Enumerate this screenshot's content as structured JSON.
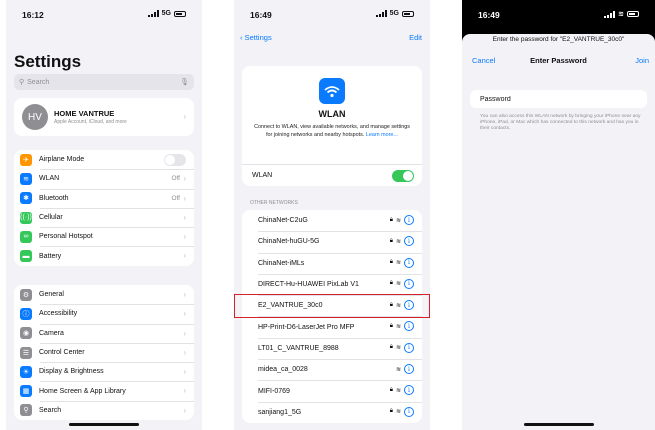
{
  "panel1": {
    "time": "16:12",
    "network": "5G",
    "title": "Settings",
    "search_placeholder": "Search",
    "account": {
      "initials": "HV",
      "name": "HOME VANTRUE",
      "subtitle": "Apple Account, iCloud, and more"
    },
    "network_group": [
      {
        "label": "Airplane Mode",
        "value": "",
        "icon": "airplane-icon",
        "color": "#ff9500",
        "glyph": "✈",
        "toggle": true
      },
      {
        "label": "WLAN",
        "value": "Off",
        "icon": "wifi-icon",
        "color": "#0a7aff",
        "glyph": "≋",
        "toggle": false
      },
      {
        "label": "Bluetooth",
        "value": "Off",
        "icon": "bluetooth-icon",
        "color": "#0a7aff",
        "glyph": "✱",
        "toggle": false
      },
      {
        "label": "Cellular",
        "value": "",
        "icon": "cellular-icon",
        "color": "#34c759",
        "glyph": "((·))",
        "toggle": false
      },
      {
        "label": "Personal Hotspot",
        "value": "",
        "icon": "hotspot-icon",
        "color": "#34c759",
        "glyph": "∞",
        "toggle": false
      },
      {
        "label": "Battery",
        "value": "",
        "icon": "battery-icon",
        "color": "#34c759",
        "glyph": "▬",
        "toggle": false
      }
    ],
    "general_group": [
      {
        "label": "General",
        "icon": "gear-icon",
        "color": "#8e8e93",
        "glyph": "⚙"
      },
      {
        "label": "Accessibility",
        "icon": "accessibility-icon",
        "color": "#0a7aff",
        "glyph": "ⓘ"
      },
      {
        "label": "Camera",
        "icon": "camera-icon",
        "color": "#8e8e93",
        "glyph": "◉"
      },
      {
        "label": "Control Center",
        "icon": "control-center-icon",
        "color": "#8e8e93",
        "glyph": "☰"
      },
      {
        "label": "Display & Brightness",
        "icon": "brightness-icon",
        "color": "#0a7aff",
        "glyph": "☀"
      },
      {
        "label": "Home Screen & App Library",
        "icon": "home-screen-icon",
        "color": "#0a7aff",
        "glyph": "▦"
      },
      {
        "label": "Search",
        "icon": "search-icon",
        "color": "#8e8e93",
        "glyph": "⚲"
      }
    ]
  },
  "panel2": {
    "time": "16:49",
    "network": "5G",
    "back_label": "Settings",
    "edit_label": "Edit",
    "wlan_title": "WLAN",
    "description": "Connect to WLAN, view available networks, and manage settings for joining networks and nearby hotspots.",
    "learn_more": "Learn more...",
    "toggle_label": "WLAN",
    "section_header": "OTHER NETWORKS",
    "networks": [
      {
        "name": "ChinaNet-C2uG",
        "locked": true
      },
      {
        "name": "ChinaNet-huGU-5G",
        "locked": true
      },
      {
        "name": "ChinaNet-iMLs",
        "locked": true
      },
      {
        "name": "DIRECT-Hu-HUAWEI PixLab V1",
        "locked": true
      },
      {
        "name": "E2_VANTRUE_30c0",
        "locked": true
      },
      {
        "name": "HP-Print-D6-LaserJet Pro MFP",
        "locked": true
      },
      {
        "name": "LT01_C_VANTRUE_8988",
        "locked": true
      },
      {
        "name": "midea_ca_0028",
        "locked": false
      },
      {
        "name": "MIFI-0769",
        "locked": true
      },
      {
        "name": "sanjiang1_5G",
        "locked": true
      }
    ]
  },
  "panel3": {
    "time": "16:49",
    "prompt": "Enter the password for \"E2_VANTRUE_30c0\"",
    "cancel_label": "Cancel",
    "title": "Enter Password",
    "join_label": "Join",
    "password_placeholder": "Password",
    "hint": "You can also access this WLAN network by bringing your iPhone near any iPhone, iPad, or Mac which has connected to this network and has you in their contacts."
  }
}
